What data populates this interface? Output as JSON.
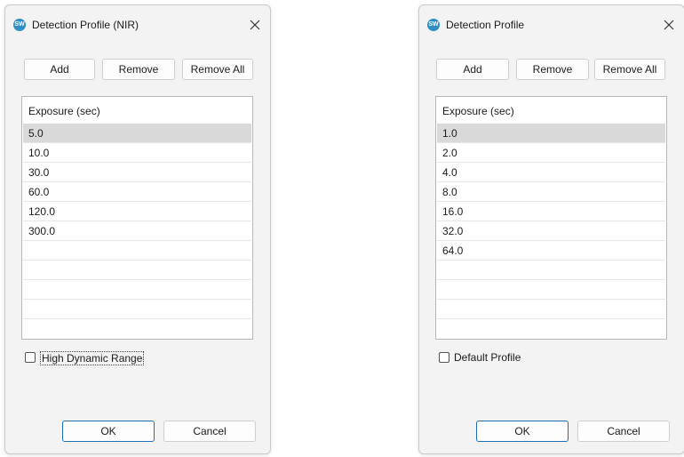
{
  "dialogs": [
    {
      "title": "Detection Profile (NIR)",
      "app_icon": "sw-logo-icon",
      "buttons": {
        "add": "Add",
        "remove": "Remove",
        "remove_all": "Remove All",
        "ok": "OK",
        "cancel": "Cancel"
      },
      "list": {
        "header": "Exposure (sec)",
        "rows": [
          "5.0",
          "10.0",
          "30.0",
          "60.0",
          "120.0",
          "300.0"
        ],
        "selected_index": 0
      },
      "checkbox": {
        "label": "High Dynamic Range",
        "checked": false
      }
    },
    {
      "title": "Detection Profile",
      "app_icon": "sw-logo-icon",
      "buttons": {
        "add": "Add",
        "remove": "Remove",
        "remove_all": "Remove All",
        "ok": "OK",
        "cancel": "Cancel"
      },
      "list": {
        "header": "Exposure (sec)",
        "rows": [
          "1.0",
          "2.0",
          "4.0",
          "8.0",
          "16.0",
          "32.0",
          "64.0"
        ],
        "selected_index": 0
      },
      "checkbox": {
        "label": "Default Profile",
        "checked": false
      }
    }
  ],
  "colors": {
    "accent": "#1f6fb5",
    "app_icon": "#2f8fc4",
    "selection": "#d9d9d9",
    "dialog_bg": "#f3f3f3"
  }
}
